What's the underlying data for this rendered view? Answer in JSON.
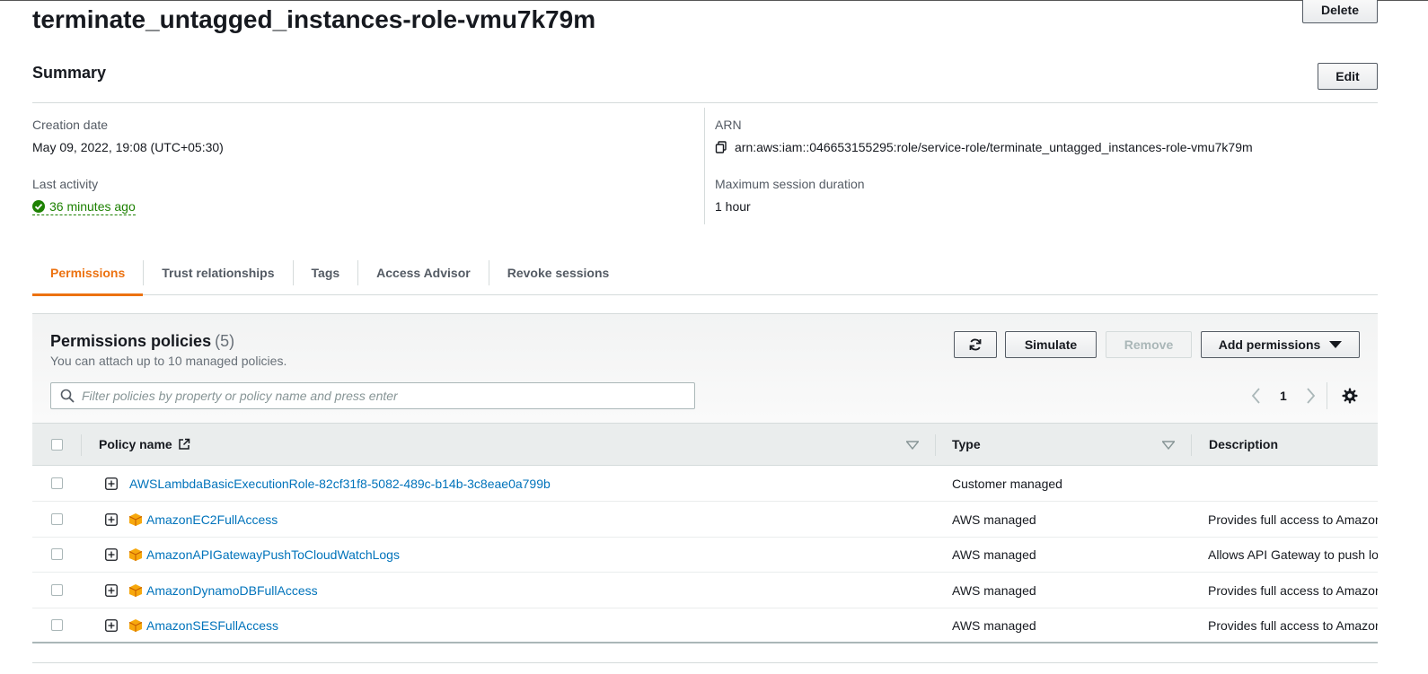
{
  "page": {
    "title": "terminate_untagged_instances-role-vmu7k79m",
    "delete_label": "Delete"
  },
  "summary": {
    "title": "Summary",
    "edit_label": "Edit",
    "creation_date_label": "Creation date",
    "creation_date": "May 09, 2022, 19:08 (UTC+05:30)",
    "last_activity_label": "Last activity",
    "last_activity": "36 minutes ago",
    "arn_label": "ARN",
    "arn": "arn:aws:iam::046653155295:role/service-role/terminate_untagged_instances-role-vmu7k79m",
    "max_session_label": "Maximum session duration",
    "max_session": "1 hour"
  },
  "tabs": [
    {
      "label": "Permissions",
      "active": true
    },
    {
      "label": "Trust relationships",
      "active": false
    },
    {
      "label": "Tags",
      "active": false
    },
    {
      "label": "Access Advisor",
      "active": false
    },
    {
      "label": "Revoke sessions",
      "active": false
    }
  ],
  "policies": {
    "title": "Permissions policies",
    "count": "(5)",
    "subtitle": "You can attach up to 10 managed policies.",
    "simulate_label": "Simulate",
    "remove_label": "Remove",
    "add_permissions_label": "Add permissions",
    "search_placeholder": "Filter policies by property or policy name and press enter",
    "page_number": "1",
    "columns": {
      "policy_name": "Policy name",
      "type": "Type",
      "description": "Description"
    },
    "rows": [
      {
        "name": "AWSLambdaBasicExecutionRole-82cf31f8-5082-489c-b14b-3c8eae0a799b",
        "type": "Customer managed",
        "description": "",
        "aws_icon": false
      },
      {
        "name": "AmazonEC2FullAccess",
        "type": "AWS managed",
        "description": "Provides full access to Amazon",
        "aws_icon": true
      },
      {
        "name": "AmazonAPIGatewayPushToCloudWatchLogs",
        "type": "AWS managed",
        "description": "Allows API Gateway to push lo",
        "aws_icon": true
      },
      {
        "name": "AmazonDynamoDBFullAccess",
        "type": "AWS managed",
        "description": "Provides full access to Amazon",
        "aws_icon": true
      },
      {
        "name": "AmazonSESFullAccess",
        "type": "AWS managed",
        "description": "Provides full access to Amazon",
        "aws_icon": true
      }
    ]
  },
  "colors": {
    "accent": "#ec7211",
    "link": "#0073bb",
    "success": "#1d8102"
  }
}
